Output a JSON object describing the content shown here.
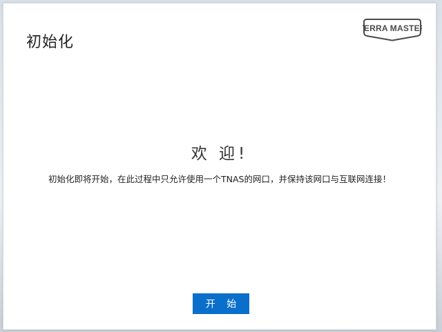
{
  "dialog": {
    "title": "初始化",
    "logo_text": "TERRA MASTER",
    "welcome": "欢 迎!",
    "message": "初始化即将开始，在此过程中只允许使用一个TNAS的网口，并保持该网口与互联网连接！",
    "start_label": "开 始"
  },
  "colors": {
    "accent": "#0a6fcb",
    "logo": "#4a4a4a"
  }
}
